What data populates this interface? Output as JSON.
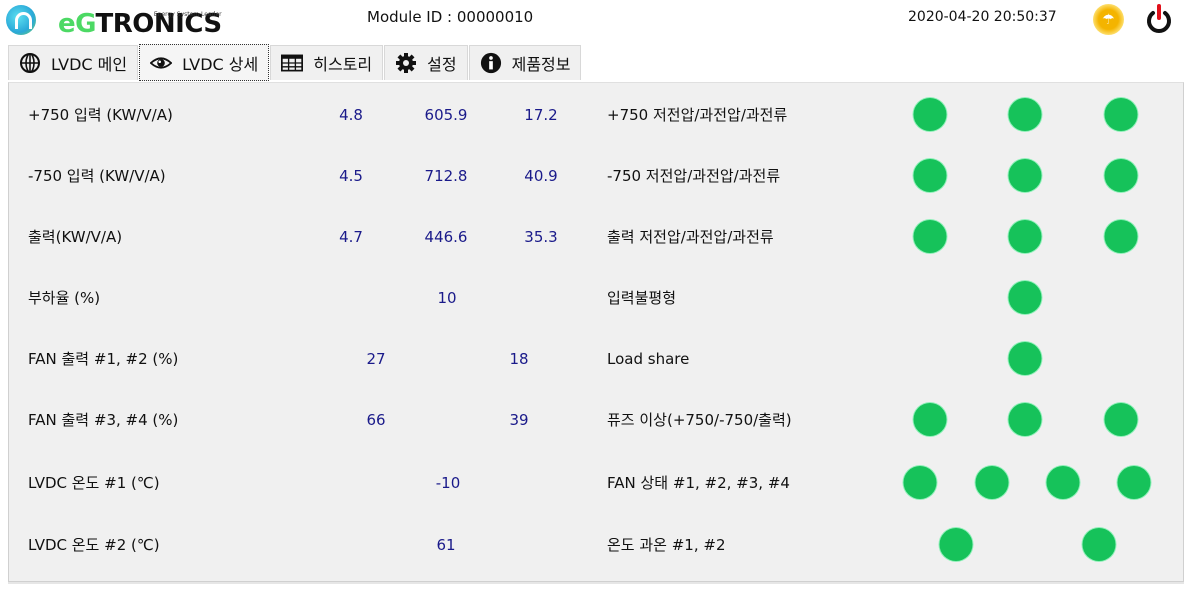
{
  "header": {
    "logo_eg": "eG",
    "logo_rest": "TRONICS",
    "logo_tagline": "Energy System Leader",
    "module_id_label": "Module ID : 00000010",
    "datetime": "2020-04-20 20:50:37",
    "weather_icon": "weather-icon",
    "power_icon": "power-icon"
  },
  "tabs": [
    {
      "label": "LVDC 메인",
      "icon": "globe-icon",
      "active": false
    },
    {
      "label": "LVDC 상세",
      "icon": "eye-icon",
      "active": true
    },
    {
      "label": "히스토리",
      "icon": "table-icon",
      "active": false
    },
    {
      "label": "설정",
      "icon": "gear-icon",
      "active": false
    },
    {
      "label": "제품정보",
      "icon": "info-icon",
      "active": false
    }
  ],
  "measurements": [
    {
      "label": "+750 입력 (KW/V/A)",
      "values": [
        "4.8",
        "605.9",
        "17.2"
      ]
    },
    {
      "label": "-750 입력 (KW/V/A)",
      "values": [
        "4.5",
        "712.8",
        "40.9"
      ]
    },
    {
      "label": "출력(KW/V/A)",
      "values": [
        "4.7",
        "446.6",
        "35.3"
      ]
    },
    {
      "label": "부하율 (%)",
      "values": [
        "10"
      ]
    },
    {
      "label": "FAN 출력 #1, #2 (%)",
      "values": [
        "27",
        "18"
      ]
    },
    {
      "label": "FAN 출력 #3, #4 (%)",
      "values": [
        "66",
        "39"
      ]
    },
    {
      "label": "LVDC 온도 #1 (℃)",
      "values": [
        "-10"
      ]
    },
    {
      "label": "LVDC 온도 #2 (℃)",
      "values": [
        "61"
      ]
    }
  ],
  "status": [
    {
      "label": "+750 저전압/과전압/과전류",
      "leds": [
        "ok",
        "ok",
        "ok"
      ]
    },
    {
      "label": "-750 저전압/과전압/과전류",
      "leds": [
        "ok",
        "ok",
        "ok"
      ]
    },
    {
      "label": "출력 저전압/과전압/과전류",
      "leds": [
        "ok",
        "ok",
        "ok"
      ]
    },
    {
      "label": "입력불평형",
      "leds": [
        "ok"
      ]
    },
    {
      "label": "Load share",
      "leds": [
        "ok"
      ]
    },
    {
      "label": "퓨즈 이상(+750/-750/출력)",
      "leds": [
        "ok",
        "ok",
        "ok"
      ]
    },
    {
      "label": "FAN 상태 #1, #2, #3, #4",
      "leds": [
        "ok",
        "ok",
        "ok",
        "ok"
      ]
    },
    {
      "label": "온도 과온 #1, #2",
      "leds": [
        "ok",
        "ok"
      ]
    }
  ],
  "colors": {
    "led_ok": "#16c25a",
    "value_text": "#1a1a8a",
    "logo_accent": "#4cd964"
  }
}
